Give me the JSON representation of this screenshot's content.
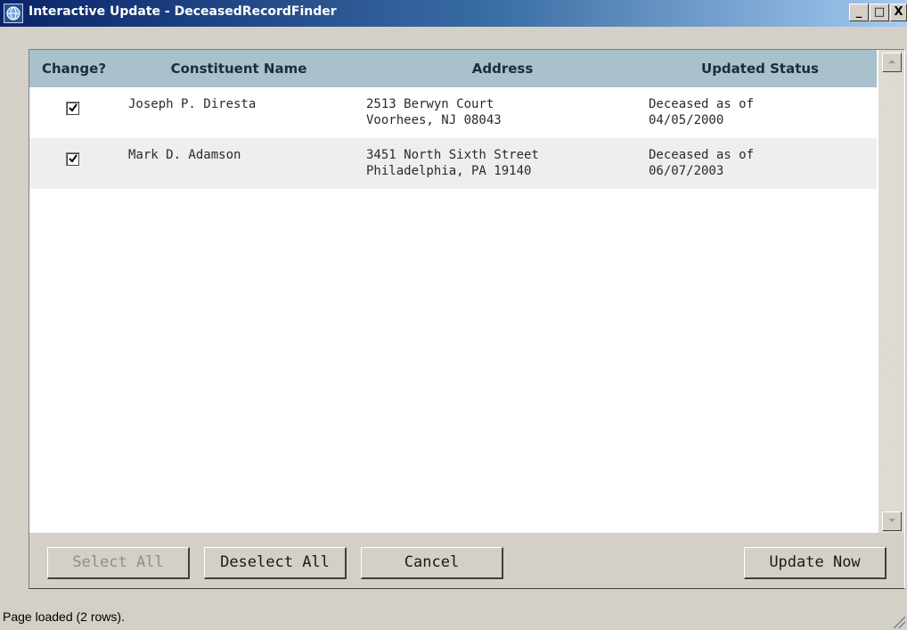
{
  "window": {
    "title": "Interactive Update - DeceasedRecordFinder",
    "controls": {
      "minimize": "_",
      "maximize": "□",
      "close": "X"
    }
  },
  "grid": {
    "columns": [
      "Change?",
      "Constituent Name",
      "Address",
      "Updated Status"
    ],
    "rows": [
      {
        "checked": true,
        "name": "Joseph P. Diresta",
        "address_line1": "2513 Berwyn Court",
        "address_line2": "Voorhees, NJ 08043",
        "status_line1": "Deceased as of",
        "status_line2": "04/05/2000"
      },
      {
        "checked": true,
        "name": "Mark D. Adamson",
        "address_line1": "3451 North Sixth Street",
        "address_line2": "Philadelphia, PA 19140",
        "status_line1": "Deceased as of",
        "status_line2": "06/07/2003"
      }
    ],
    "row_colors": [
      "#ffffff",
      "#eeeeee"
    ],
    "header_color": "#a9c1cc"
  },
  "buttons": {
    "select_all": "Select All",
    "deselect_all": "Deselect All",
    "cancel": "Cancel",
    "update_now": "Update Now"
  },
  "status_bar": {
    "text": "Page loaded (2 rows)."
  },
  "icons": {
    "scroll_up": "scroll-up-arrow-icon",
    "scroll_down": "scroll-down-arrow-icon",
    "checkmark": "checkmark-icon"
  }
}
